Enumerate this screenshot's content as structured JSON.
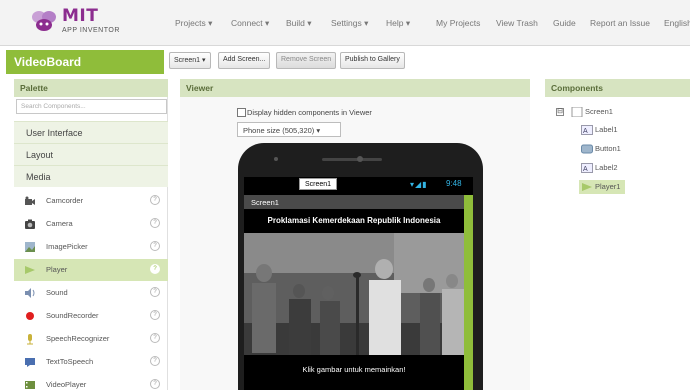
{
  "app": {
    "logo_text": "MIT",
    "logo_sub": "APP INVENTOR",
    "project_name": "VideoBoard"
  },
  "menu": [
    "Projects ▾",
    "Connect ▾",
    "Build ▾",
    "Settings ▾",
    "Help ▾",
    "My Projects",
    "View Trash",
    "Guide",
    "Report an Issue",
    "English"
  ],
  "toolbar": {
    "screen_select": "Screen1 ▾",
    "add_screen": "Add Screen...",
    "remove_screen": "Remove Screen",
    "publish": "Publish to Gallery"
  },
  "palette": {
    "title": "Palette",
    "search_placeholder": "Search Components...",
    "categories": [
      "User Interface",
      "Layout",
      "Media"
    ],
    "items": [
      "Camcorder",
      "Camera",
      "ImagePicker",
      "Player",
      "Sound",
      "SoundRecorder",
      "SpeechRecognizer",
      "TextToSpeech",
      "VideoPlayer"
    ],
    "selected": "Player",
    "help_glyph": "?"
  },
  "viewer": {
    "title": "Viewer",
    "hidden_label": "Display hidden components in Viewer",
    "phone_size": "Phone size (505,320)  ▾",
    "screen_tag": "Screen1",
    "time": "9:48",
    "title_bar": "Screen1",
    "label1": "Proklamasi Kemerdekaan Republik Indonesia",
    "label2": "Klik gambar untuk memainkan!"
  },
  "components": {
    "title": "Components",
    "collapse_glyph": "⊟",
    "tree": [
      "Screen1",
      "Label1",
      "Button1",
      "Label2",
      "Player1"
    ],
    "selected": "Player1"
  },
  "colors": {
    "accent": "#8fbd3a",
    "header_bg": "#d7e4c1",
    "logo": "#8c2d8f",
    "status_blue": "#33b5e5"
  }
}
